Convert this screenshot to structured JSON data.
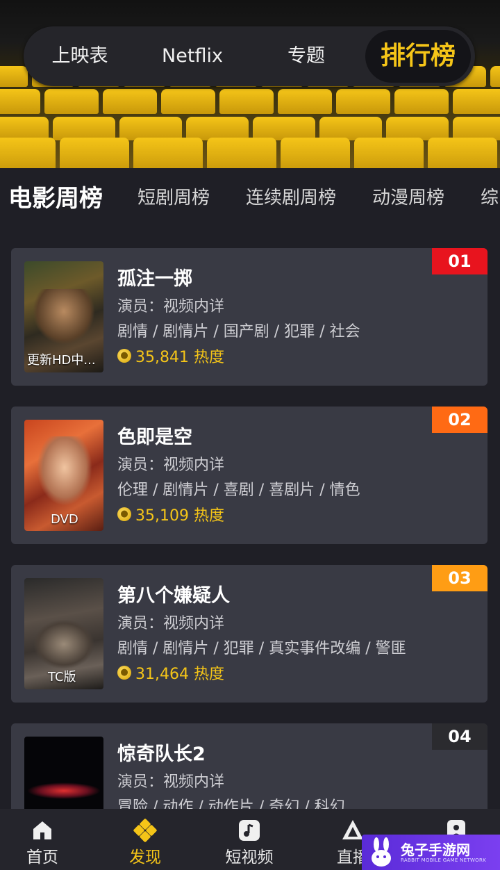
{
  "top_tabs": [
    {
      "label": "上映表"
    },
    {
      "label": "Netflix"
    },
    {
      "label": "专题"
    },
    {
      "label": "排行榜"
    }
  ],
  "categories": [
    {
      "label": "电影周榜"
    },
    {
      "label": "短剧周榜"
    },
    {
      "label": "连续剧周榜"
    },
    {
      "label": "动漫周榜"
    },
    {
      "label": "综"
    }
  ],
  "movies": [
    {
      "rank": "01",
      "rank_color": "#e8141e",
      "title": "孤注一掷",
      "actor": "演员：视频内详",
      "genres": "剧情 / 剧情片 / 国产剧 / 犯罪 / 社会",
      "heat": "35,841 热度",
      "poster_tag": "更新HD中..."
    },
    {
      "rank": "02",
      "rank_color": "#ff6a14",
      "title": "色即是空",
      "actor": "演员：视频内详",
      "genres": "伦理 / 剧情片 / 喜剧 / 喜剧片 / 情色",
      "heat": "35,109 热度",
      "poster_tag": "DVD"
    },
    {
      "rank": "03",
      "rank_color": "#ff9d14",
      "title": "第八个嫌疑人",
      "actor": "演员：视频内详",
      "genres": "剧情 / 剧情片 / 犯罪 / 真实事件改编 / 警匪",
      "heat": "31,464 热度",
      "poster_tag": "TC版"
    },
    {
      "rank": "04",
      "rank_color": "#2b2b2f",
      "title": "惊奇队长2",
      "actor": "演员：视频内详",
      "genres": "冒险 / 动作 / 动作片 / 奇幻 / 科幻",
      "heat": "",
      "poster_tag": ""
    }
  ],
  "bottom_nav": [
    {
      "label": "首页",
      "icon": "home-icon"
    },
    {
      "label": "发现",
      "icon": "discover-icon"
    },
    {
      "label": "短视频",
      "icon": "short-video-icon"
    },
    {
      "label": "直播",
      "icon": "live-icon"
    },
    {
      "label": "",
      "icon": "profile-icon"
    }
  ],
  "watermark": {
    "text": "兔子手游网",
    "sub": "RABBIT MOBILE GAME NETWORK"
  }
}
